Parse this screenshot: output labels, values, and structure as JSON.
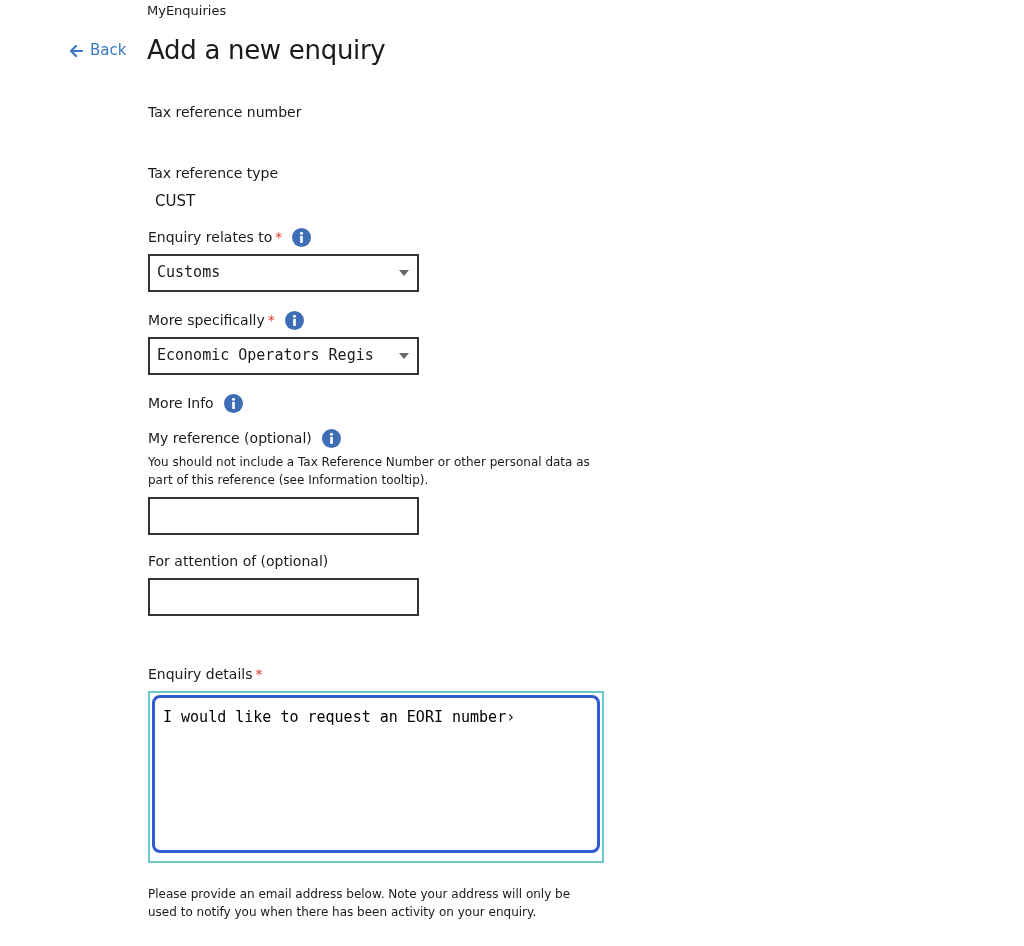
{
  "breadcrumb": "MyEnquiries",
  "back_link": "Back",
  "title": "Add a new enquiry",
  "fields": [
    {
      "kind": "static",
      "label": "Tax reference number"
    },
    {
      "kind": "static",
      "label": "Tax reference type",
      "value": "CUST"
    },
    {
      "kind": "select",
      "label": "Enquiry relates to",
      "required_mark": "*",
      "info": true,
      "value": "Customs"
    },
    {
      "kind": "select",
      "label": "More specifically",
      "required_mark": "*",
      "info": true,
      "value": "Economic Operators Regis"
    },
    {
      "kind": "static",
      "label": "More Info",
      "info": true
    },
    {
      "kind": "text",
      "label": "My reference (optional)",
      "info": true,
      "hint": "You should not include a Tax Reference Number or other personal data as part of this reference (see Information tooltip)."
    },
    {
      "kind": "text",
      "label": "For attention of (optional)"
    },
    {
      "kind": "textarea",
      "label": "Enquiry details",
      "required_mark": "*",
      "focused": true,
      "value": "I would like to request an EORI number›"
    }
  ],
  "note": "Please provide an email address below. Note your address will only be used to notify you when there has been activity on your enquiry."
}
